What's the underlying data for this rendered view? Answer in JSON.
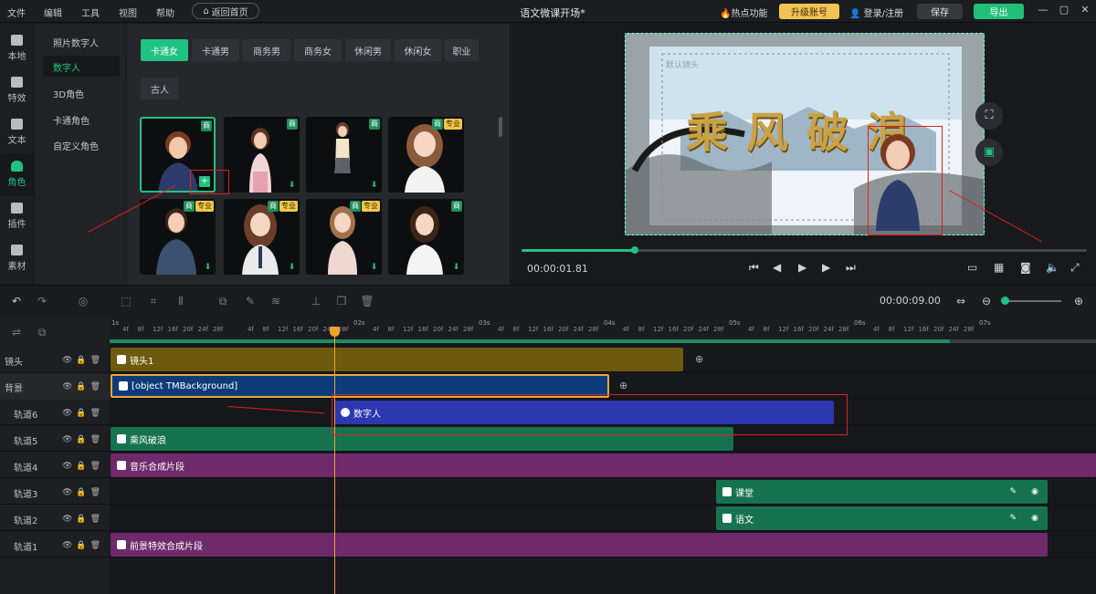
{
  "menu": [
    "文件",
    "编辑",
    "工具",
    "视图",
    "帮助"
  ],
  "home_button": "返回首页",
  "title": "语文微课开场*",
  "hot_func": "热点功能",
  "upgrade": "升级账号",
  "login": "登录/注册",
  "save": "保存",
  "export": "导出",
  "left_nav": [
    "本地",
    "特效",
    "文本",
    "角色",
    "插件",
    "素材"
  ],
  "sub_menu": [
    "照片数字人",
    "数字人",
    "3D角色",
    "卡通角色",
    "自定义角色"
  ],
  "filters": [
    "卡通女",
    "卡通男",
    "商务男",
    "商务女",
    "休闲男",
    "休闲女",
    "职业",
    "古人"
  ],
  "badges": {
    "shang": "商",
    "pro": "专业"
  },
  "preview": {
    "time": "00:00:01.81",
    "canvas_label": "默认镜头",
    "headline": "乘风破浪"
  },
  "timeline": {
    "duration": "00:00:09.00",
    "seconds": [
      "1s",
      "02s",
      "03s",
      "04s",
      "05s",
      "06s",
      "07s"
    ],
    "ticks": [
      "4f",
      "8f",
      "12f",
      "16f",
      "20f",
      "24f",
      "28f"
    ],
    "tracks": [
      "镜头",
      "背景",
      "轨道6",
      "轨道5",
      "轨道4",
      "轨道3",
      "轨道2",
      "轨道1"
    ],
    "clips": {
      "shot": "镜头1",
      "background": "[object TMBackground]",
      "digital": "数字人",
      "text5": "乘风破浪",
      "music": "音乐合成片段",
      "class": "课堂",
      "chinese": "语文",
      "fx": "前景特效合成片段"
    }
  },
  "colors": {
    "accent": "#20c282",
    "shot": "#6e5a0c",
    "background": "#0e3c78",
    "digital": "#2c37b0",
    "text": "#177250",
    "merge": "#6e2a6a"
  }
}
